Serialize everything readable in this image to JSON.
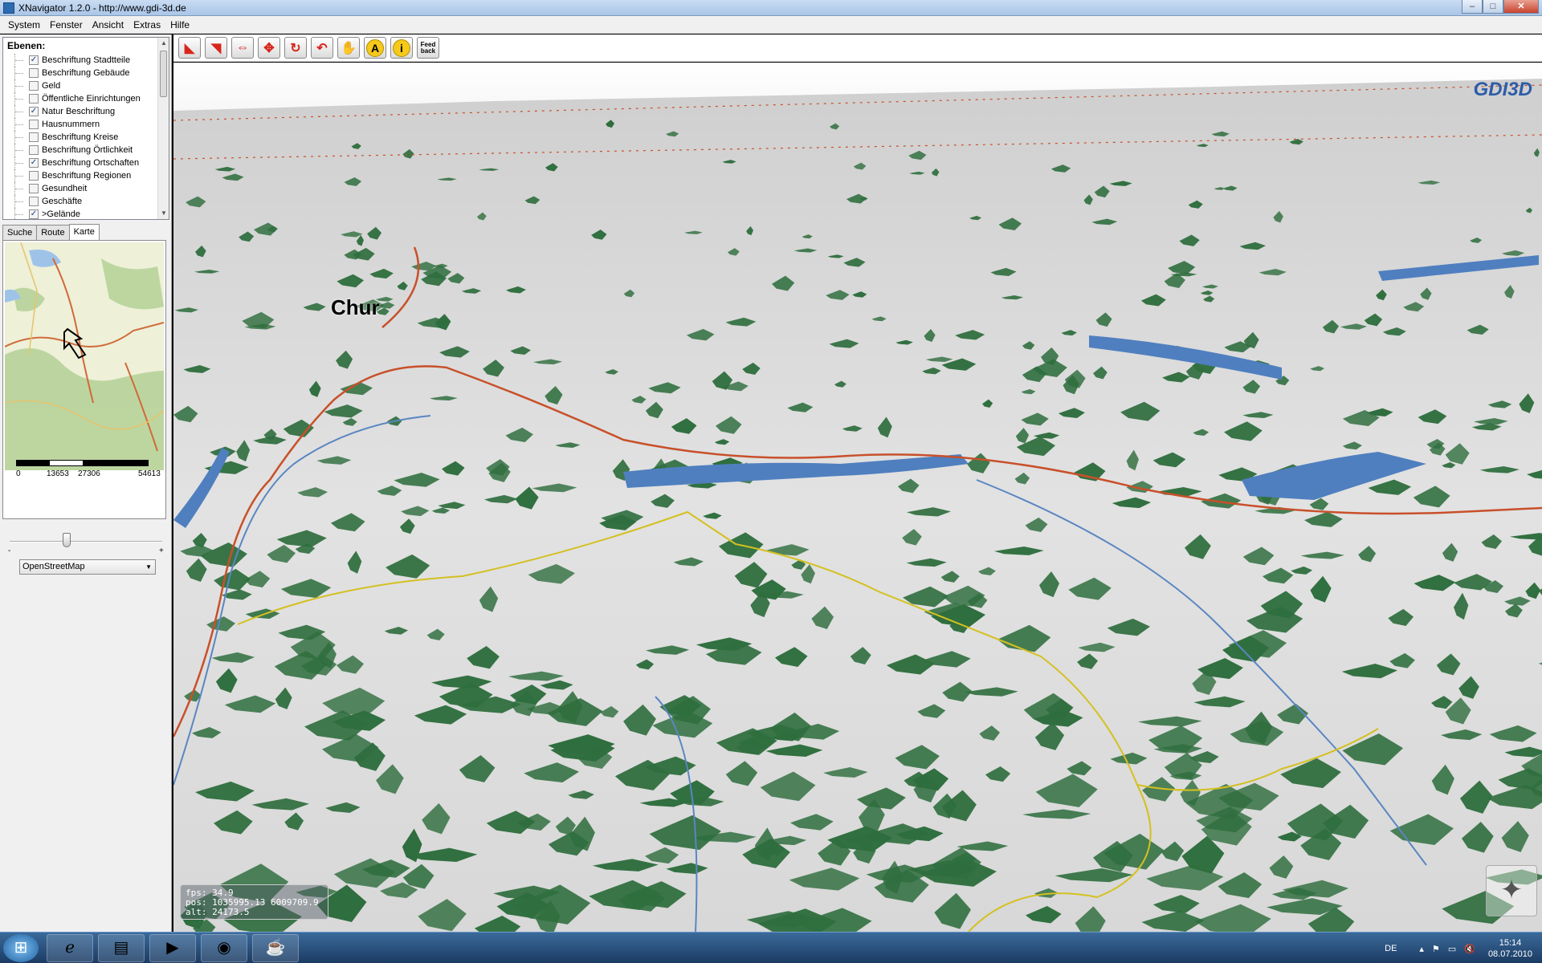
{
  "window": {
    "title": "XNavigator 1.2.0 - http://www.gdi-3d.de",
    "minimize": "–",
    "maximize": "□",
    "close": "✕"
  },
  "menu": [
    "System",
    "Fenster",
    "Ansicht",
    "Extras",
    "Hilfe"
  ],
  "layers": {
    "heading": "Ebenen:",
    "items": [
      {
        "label": "Beschriftung Stadtteile",
        "checked": true
      },
      {
        "label": "Beschriftung Gebäude",
        "checked": false
      },
      {
        "label": "Geld",
        "checked": false
      },
      {
        "label": "Öffentliche Einrichtungen",
        "checked": false
      },
      {
        "label": "Natur Beschriftung",
        "checked": true
      },
      {
        "label": "Hausnummern",
        "checked": false
      },
      {
        "label": "Beschriftung Kreise",
        "checked": false
      },
      {
        "label": "Beschriftung Örtlichkeit",
        "checked": false
      },
      {
        "label": "Beschriftung Ortschaften",
        "checked": true
      },
      {
        "label": "Beschriftung Regionen",
        "checked": false
      },
      {
        "label": "Gesundheit",
        "checked": false
      },
      {
        "label": "Geschäfte",
        "checked": false
      },
      {
        "label": ">Gelände",
        "checked": true
      }
    ]
  },
  "tabs": [
    "Suche",
    "Route",
    "Karte"
  ],
  "active_tab": "Karte",
  "minimap": {
    "scale_labels": [
      "0",
      "13653",
      "27306",
      "54613"
    ],
    "slider_minus": "-",
    "slider_plus": "+",
    "map_source": "OpenStreetMap"
  },
  "toolbar": {
    "buttons": [
      {
        "name": "rotate-left",
        "glyph": "◣"
      },
      {
        "name": "tilt",
        "glyph": "◥"
      },
      {
        "name": "pan-horizontal",
        "glyph": "⇔"
      },
      {
        "name": "pan-vertical",
        "glyph": "✥"
      },
      {
        "name": "reset-view",
        "glyph": "↻"
      },
      {
        "name": "undo",
        "glyph": "↶"
      },
      {
        "name": "hand",
        "glyph": "✋"
      },
      {
        "name": "annotate",
        "glyph": "A"
      },
      {
        "name": "info",
        "glyph": "i"
      },
      {
        "name": "feedback",
        "glyph": "Feed back"
      }
    ]
  },
  "viewport": {
    "place_label": "Chur",
    "logo": "GDI3D",
    "stats": {
      "fps": "fps: 34.9",
      "pos": "pos: 1035995.13  6009709.9",
      "alt": "alt: 24173.5"
    }
  },
  "taskbar": {
    "language": "DE",
    "time": "15:14",
    "date": "08.07.2010"
  },
  "colors": {
    "forest": "#2f6e3e",
    "terrain": "#d6d6d6",
    "water": "#4f7fbf",
    "road": "#c8502a",
    "border": "#d4c020"
  }
}
